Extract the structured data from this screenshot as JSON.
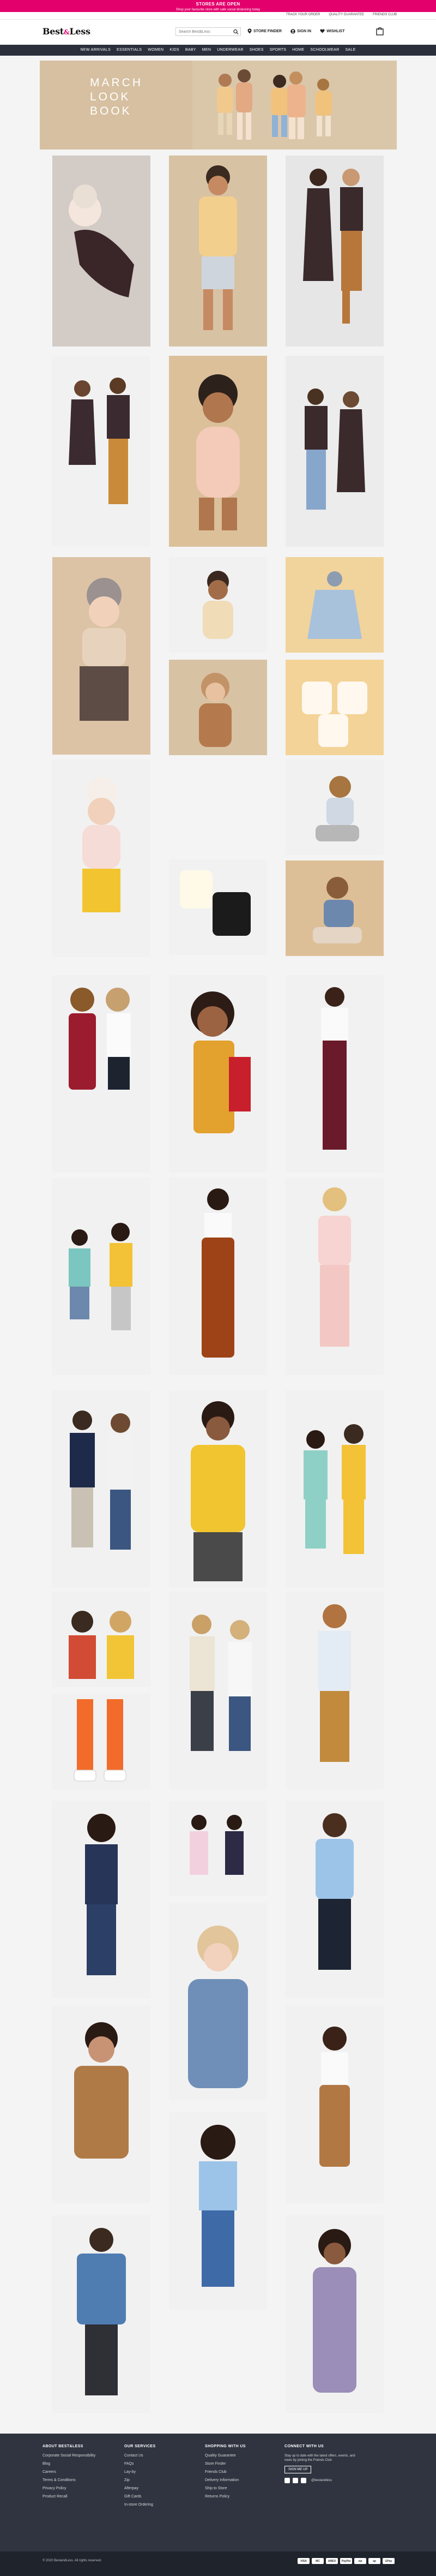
{
  "promo": {
    "title": "STORES ARE OPEN",
    "subtitle": "Shop your favourite store with safe social distancing today"
  },
  "utility_links": [
    "TRACK YOUR ORDER",
    "QUALITY GUARANTEE",
    "FRIENDS CLUB"
  ],
  "header": {
    "logo_main": "Best",
    "logo_amp": "&",
    "logo_tail": "Less",
    "search_placeholder": "Search Best&Less",
    "store_finder": "STORE FINDER",
    "sign_in": "SIGN IN",
    "wishlist": "WISHLIST"
  },
  "nav": [
    "NEW ARRIVALS",
    "ESSENTIALS",
    "WOMEN",
    "KIDS",
    "BABY",
    "MEN",
    "UNDERWEAR",
    "SHOES",
    "SPORTS",
    "HOME",
    "SCHOOLWEAR",
    "SALE"
  ],
  "hero": {
    "line1": "MARCH",
    "line2": "LOOK",
    "line3": "BOOK"
  },
  "footer": {
    "about": {
      "heading": "ABOUT BEST&LESS",
      "links": [
        "Corporate Social Responsibility",
        "Blog",
        "Careers",
        "Terms & Conditions",
        "Privacy Policy",
        "Product Recall"
      ]
    },
    "services": {
      "heading": "OUR SERVICES",
      "links": [
        "Contact Us",
        "FAQs",
        "Lay-by",
        "Zip",
        "Afterpay",
        "Gift Cards",
        "In-store Ordering"
      ]
    },
    "shopping": {
      "heading": "SHOPPING WITH US",
      "links": [
        "Quality Guarantee",
        "Store Finder",
        "Friends Club",
        "Delivery Information",
        "Ship to Store",
        "Returns Policy"
      ]
    },
    "connect": {
      "heading": "CONNECT WITH US",
      "text": "Stay up to date with the latest offers, events, and news by joining the Friends Club",
      "button": "SIGN ME UP",
      "handle": "@bestandless"
    },
    "copyright": "© 2020 BestandLess. All rights reserved.",
    "payments": [
      "VISA",
      "MC",
      "AMEX",
      "PayPal",
      "zip",
      "ap",
      "GPay"
    ]
  },
  "colors": {
    "promo_bg": "#e3006c",
    "nav_bg": "#2a2f3b",
    "footer_bg": "#2f3440",
    "hero_bg": "#d8c3a5"
  }
}
